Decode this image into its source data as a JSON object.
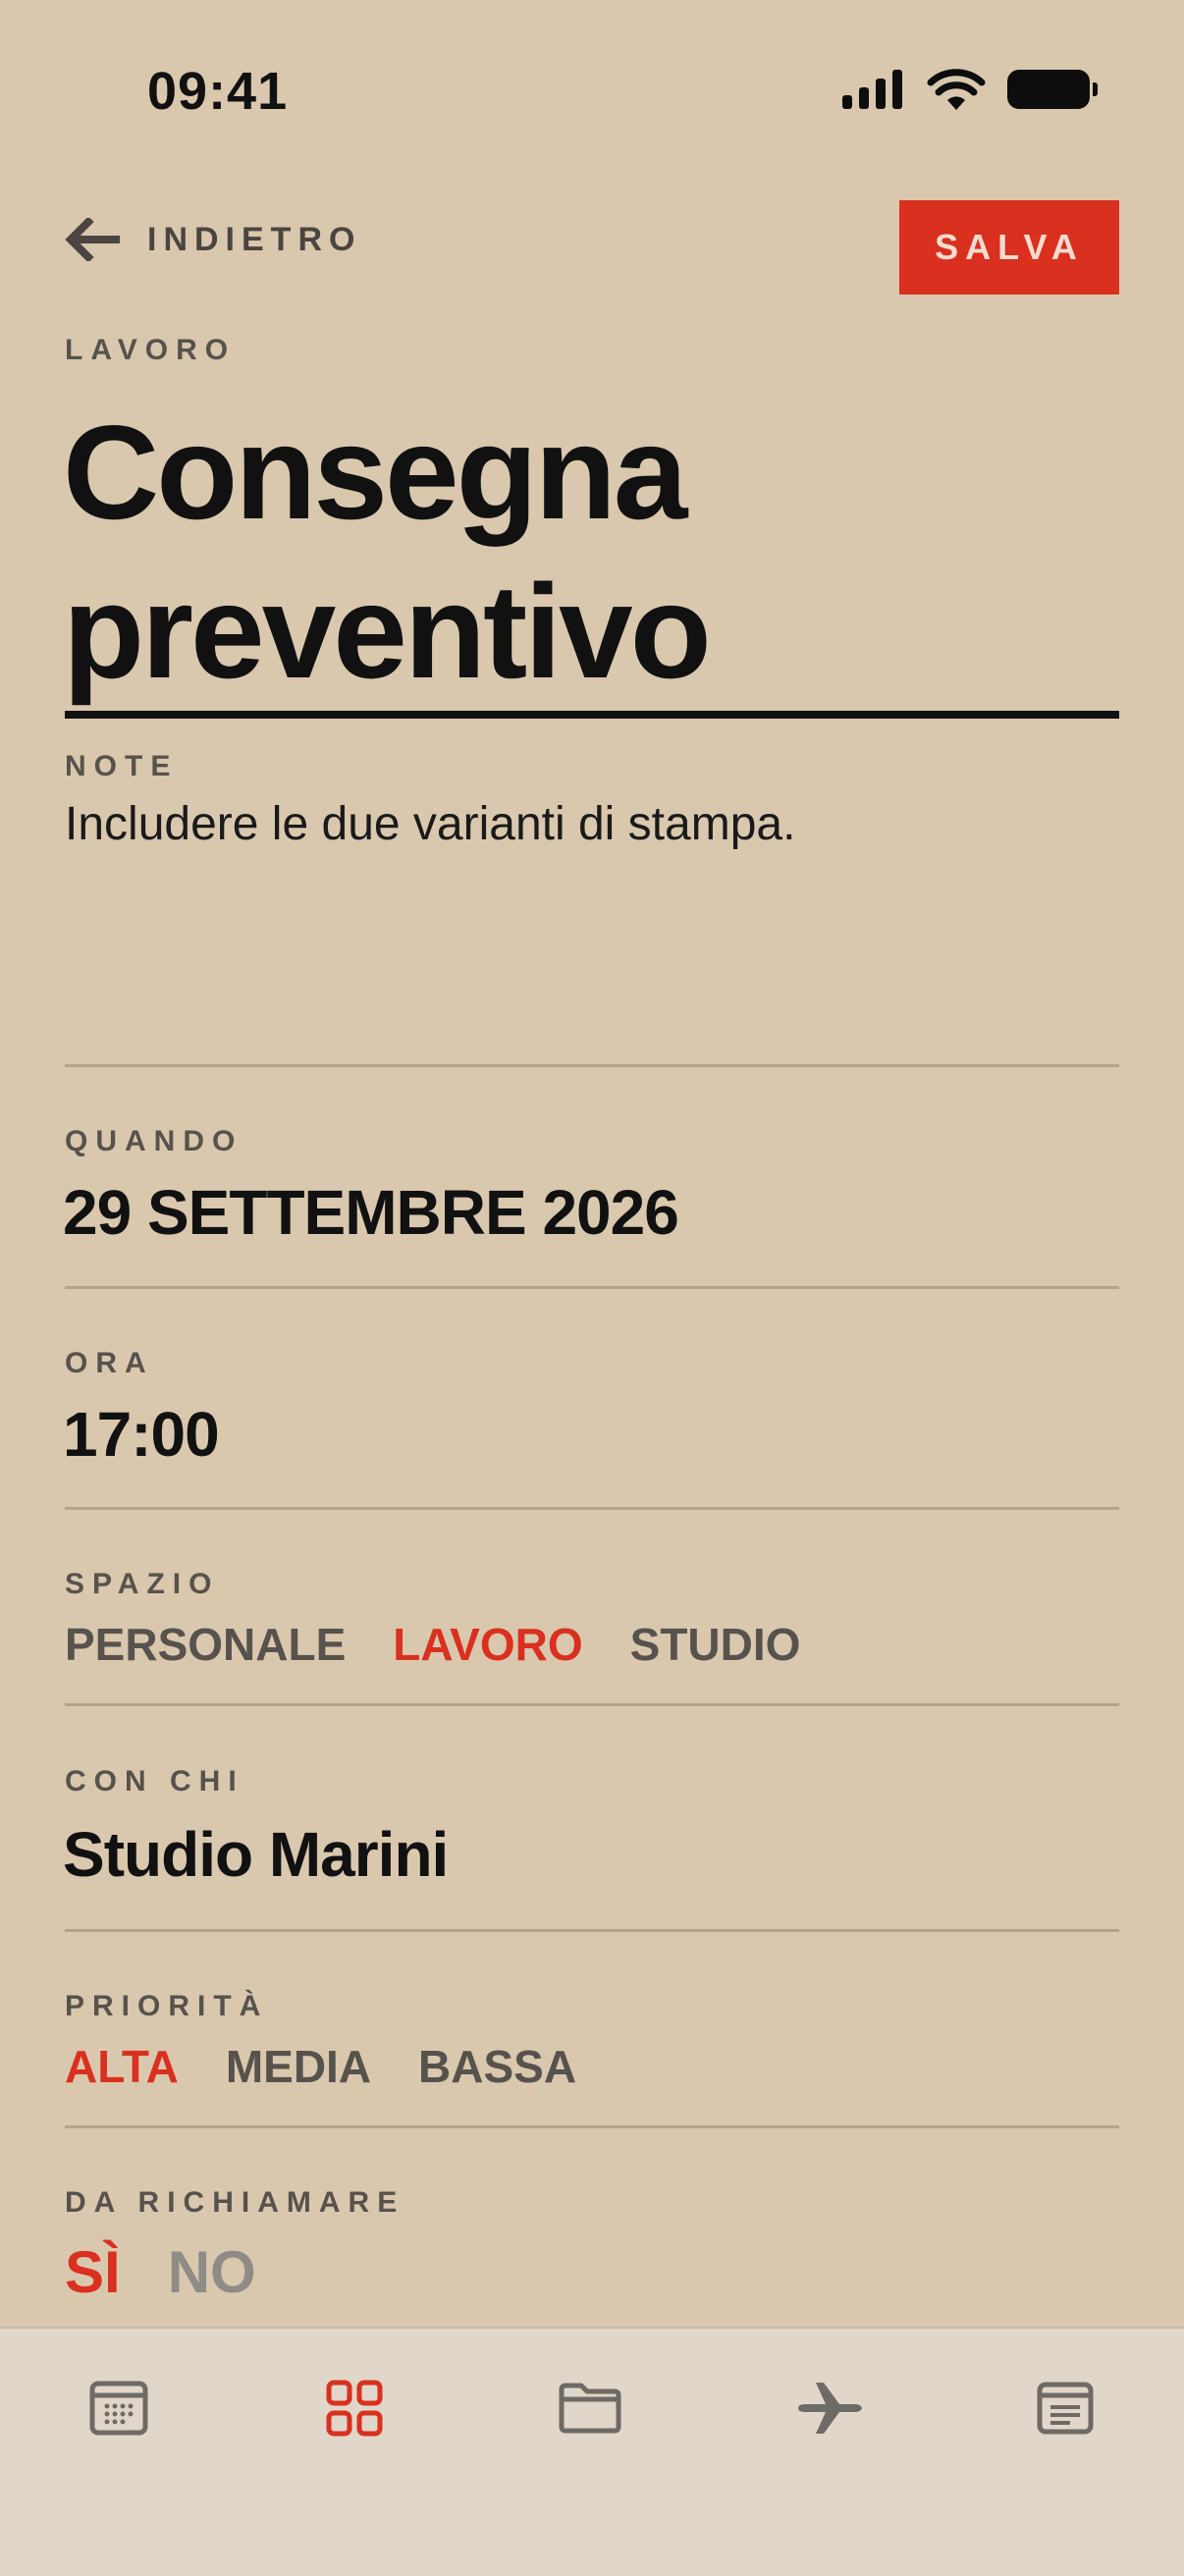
{
  "status_bar": {
    "time": "09:41"
  },
  "header": {
    "back_label": "INDIETRO",
    "save_label": "SALVA"
  },
  "task": {
    "category": "LAVORO",
    "title": "Consegna preventivo",
    "notes_label": "NOTE",
    "notes": "Includere le due varianti di stampa."
  },
  "fields": {
    "when": {
      "label": "QUANDO",
      "value": "29 SETTEMBRE 2026"
    },
    "time": {
      "label": "ORA",
      "value": "17:00"
    },
    "space": {
      "label": "SPAZIO",
      "options": [
        "PERSONALE",
        "LAVORO",
        "STUDIO"
      ],
      "selected": "LAVORO"
    },
    "with": {
      "label": "CON CHI",
      "value": "Studio Marini"
    },
    "priority": {
      "label": "PRIORITÀ",
      "options": [
        "ALTA",
        "MEDIA",
        "BASSA"
      ],
      "selected": "ALTA"
    },
    "recall": {
      "label": "DA RICHIAMARE",
      "options": [
        "SÌ",
        "NO"
      ],
      "selected": "SÌ"
    }
  },
  "tabbar": {
    "items": [
      {
        "icon": "calendar-icon",
        "active": false
      },
      {
        "icon": "grid-icon",
        "active": true
      },
      {
        "icon": "folder-icon",
        "active": false
      },
      {
        "icon": "airplane-icon",
        "active": false
      },
      {
        "icon": "notes-icon",
        "active": false
      }
    ]
  },
  "colors": {
    "background": "#d9c8ae",
    "accent": "#d9301f",
    "text": "#111111",
    "muted": "#57524c"
  }
}
